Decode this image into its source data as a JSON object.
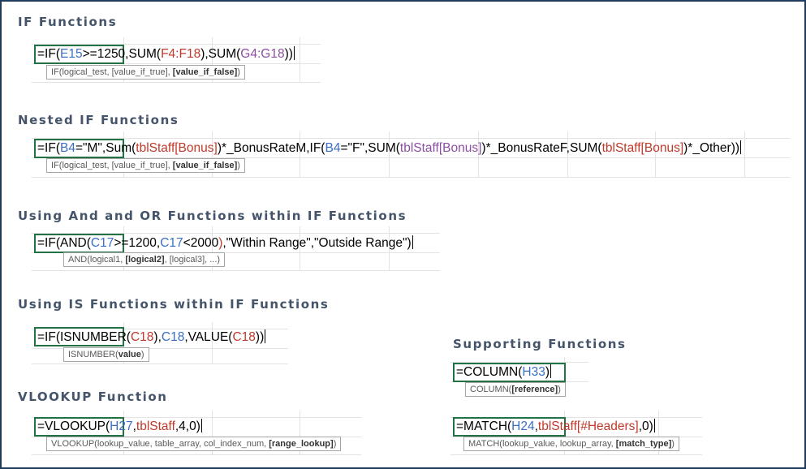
{
  "sections": [
    {
      "heading": "IF Functions",
      "formula": [
        {
          "t": "=IF(",
          "c": "c-black"
        },
        {
          "t": "E15",
          "c": "c-blue"
        },
        {
          "t": ">=1250,SUM(",
          "c": "c-black"
        },
        {
          "t": "F4:F18",
          "c": "c-red"
        },
        {
          "t": "),SUM(",
          "c": "c-black"
        },
        {
          "t": "G4:G18",
          "c": "c-purple"
        },
        {
          "t": "))",
          "c": "c-black"
        }
      ],
      "tooltip": [
        {
          "t": "IF(logical_test, [value_if_true], ",
          "b": false
        },
        {
          "t": "[value_if_false]",
          "b": true
        },
        {
          "t": ")",
          "b": false
        }
      ]
    },
    {
      "heading": "Nested IF Functions",
      "formula": [
        {
          "t": "=IF(",
          "c": "c-black"
        },
        {
          "t": "B4",
          "c": "c-blue"
        },
        {
          "t": "=\"M\",Sum(",
          "c": "c-black"
        },
        {
          "t": "tblStaff[Bonus]",
          "c": "c-red"
        },
        {
          "t": ")*_BonusRateM,IF(",
          "c": "c-black"
        },
        {
          "t": "B4",
          "c": "c-blue"
        },
        {
          "t": "=\"F\",SUM(",
          "c": "c-black"
        },
        {
          "t": "tblStaff[Bonus]",
          "c": "c-purple"
        },
        {
          "t": ")*_BonusRateF,SUM(",
          "c": "c-black"
        },
        {
          "t": "tblStaff[Bonus]",
          "c": "c-red"
        },
        {
          "t": ")*_Other))",
          "c": "c-black"
        }
      ],
      "tooltip": [
        {
          "t": "IF(logical_test, [value_if_true], ",
          "b": false
        },
        {
          "t": "[value_if_false]",
          "b": true
        },
        {
          "t": ")",
          "b": false
        }
      ]
    },
    {
      "heading": "Using And and OR Functions within IF Functions",
      "formula": [
        {
          "t": "=IF(AND(",
          "c": "c-black"
        },
        {
          "t": "C17",
          "c": "c-blue"
        },
        {
          "t": ">=1200,",
          "c": "c-black"
        },
        {
          "t": "C17",
          "c": "c-blue"
        },
        {
          "t": "<2000",
          "c": "c-black"
        },
        {
          "t": ")",
          "c": "c-red"
        },
        {
          "t": ",\"Within Range\",\"Outside Range\")",
          "c": "c-black"
        }
      ],
      "tooltip": [
        {
          "t": "AND(logical1, ",
          "b": false
        },
        {
          "t": "[logical2]",
          "b": true
        },
        {
          "t": ", [logical3], ...)",
          "b": false
        }
      ]
    },
    {
      "heading": "Using IS Functions within IF Functions",
      "formula": [
        {
          "t": "=IF(ISNUMBER(",
          "c": "c-black"
        },
        {
          "t": "C18",
          "c": "c-red"
        },
        {
          "t": "),",
          "c": "c-black"
        },
        {
          "t": "C18",
          "c": "c-blue"
        },
        {
          "t": ",VALUE(",
          "c": "c-black"
        },
        {
          "t": "C18",
          "c": "c-red"
        },
        {
          "t": "))",
          "c": "c-black"
        }
      ],
      "tooltip": [
        {
          "t": "ISNUMBER(",
          "b": false
        },
        {
          "t": "value",
          "b": true
        },
        {
          "t": ")",
          "b": false
        }
      ]
    },
    {
      "heading": "VLOOKUP Function",
      "formula": [
        {
          "t": "=VLOOKUP(",
          "c": "c-black"
        },
        {
          "t": "H27",
          "c": "c-blue"
        },
        {
          "t": ",",
          "c": "c-black"
        },
        {
          "t": "tblStaff",
          "c": "c-red"
        },
        {
          "t": ",4,0)",
          "c": "c-black"
        }
      ],
      "tooltip": [
        {
          "t": "VLOOKUP(lookup_value, table_array, col_index_num, ",
          "b": false
        },
        {
          "t": "[range_lookup]",
          "b": true
        },
        {
          "t": ")",
          "b": false
        }
      ]
    },
    {
      "heading": "Supporting Functions",
      "formula": [
        {
          "t": "=COLUMN(",
          "c": "c-black"
        },
        {
          "t": "H33",
          "c": "c-blue"
        },
        {
          "t": ")",
          "c": "c-black"
        }
      ],
      "tooltip": [
        {
          "t": "COLUMN(",
          "b": false
        },
        {
          "t": "[reference]",
          "b": true
        },
        {
          "t": ")",
          "b": false
        }
      ]
    },
    {
      "heading": "",
      "formula": [
        {
          "t": "=MATCH(",
          "c": "c-black"
        },
        {
          "t": "H24",
          "c": "c-blue"
        },
        {
          "t": ",",
          "c": "c-black"
        },
        {
          "t": "tblStaff[#Headers]",
          "c": "c-red"
        },
        {
          "t": ",0)",
          "c": "c-black"
        }
      ],
      "tooltip": [
        {
          "t": "MATCH(lookup_value, lookup_array, ",
          "b": false
        },
        {
          "t": "[match_type]",
          "b": true
        },
        {
          "t": ")",
          "b": false
        }
      ]
    }
  ]
}
